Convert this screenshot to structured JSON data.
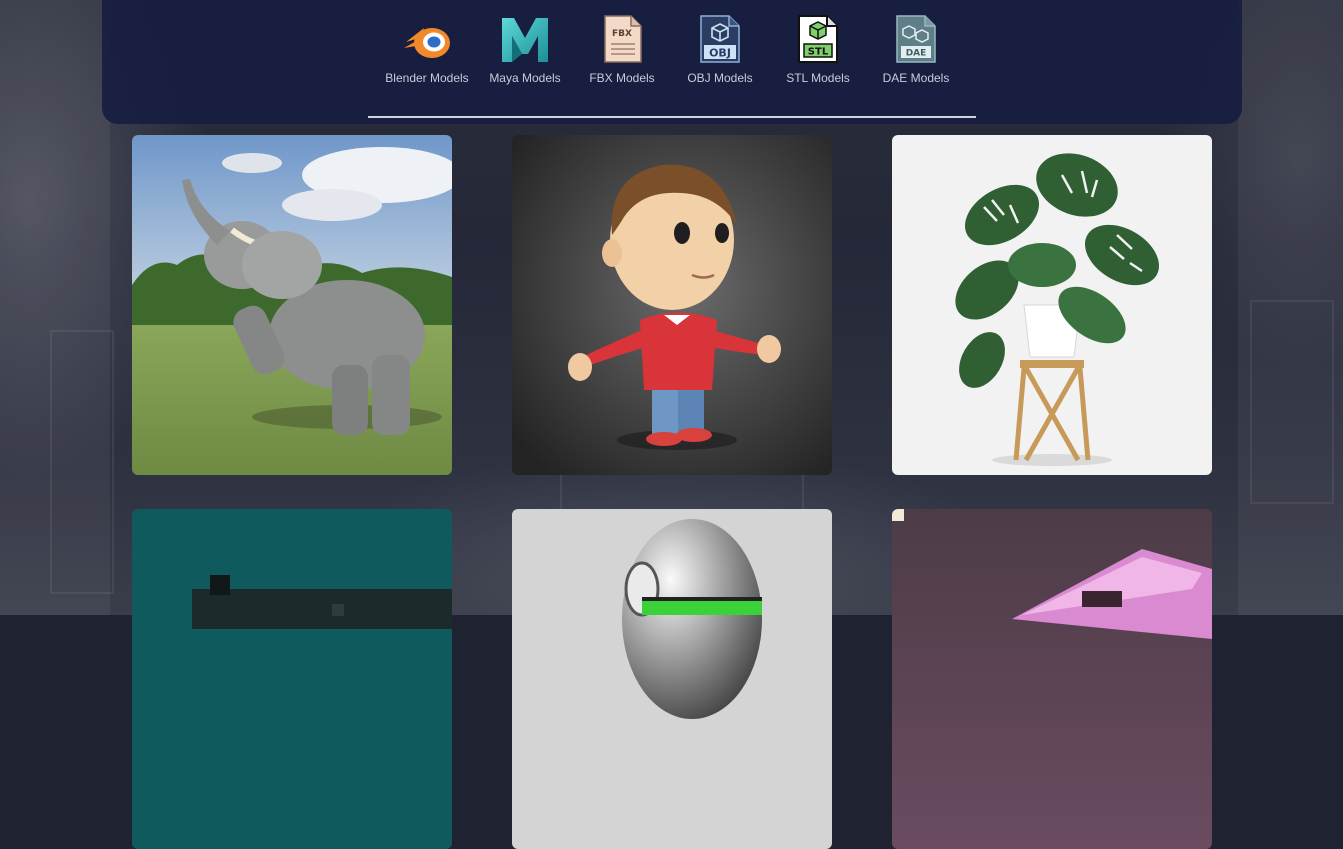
{
  "nav": {
    "items": [
      {
        "label": "Blender Models",
        "icon": "blender-icon"
      },
      {
        "label": "Maya Models",
        "icon": "maya-icon"
      },
      {
        "label": "FBX Models",
        "icon": "fbx-file-icon",
        "badge": "FBX"
      },
      {
        "label": "OBJ Models",
        "icon": "obj-file-icon",
        "badge": "OBJ"
      },
      {
        "label": "STL Models",
        "icon": "stl-file-icon",
        "badge": "STL"
      },
      {
        "label": "DAE Models",
        "icon": "dae-file-icon",
        "badge": "DAE"
      }
    ]
  },
  "gallery": {
    "cards": [
      {
        "subject": "elephant-model-thumbnail"
      },
      {
        "subject": "cartoon-boy-model-thumbnail"
      },
      {
        "subject": "monstera-plant-model-thumbnail"
      },
      {
        "subject": "teal-machine-model-thumbnail"
      },
      {
        "subject": "chrome-helmet-model-thumbnail"
      },
      {
        "subject": "pink-ceiling-model-thumbnail"
      }
    ]
  },
  "colors": {
    "panel": "#161c40",
    "label": "#c8ccd8",
    "blender_orange": "#f0892a",
    "blender_blue": "#2d6ec7",
    "maya_teal": "#2bb3b8"
  }
}
